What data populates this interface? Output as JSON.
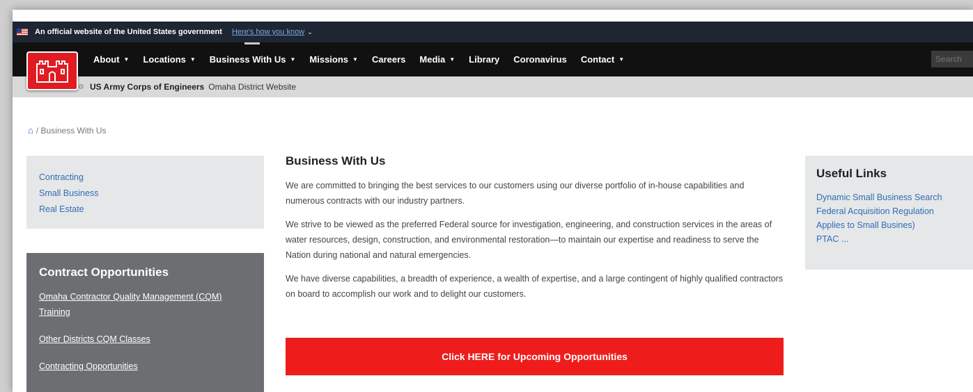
{
  "gov_banner": {
    "text": "An official website of the United States government",
    "link": "Here's how you know"
  },
  "nav": {
    "items": [
      {
        "label": "About",
        "dropdown": true
      },
      {
        "label": "Locations",
        "dropdown": true
      },
      {
        "label": "Business With Us",
        "dropdown": true
      },
      {
        "label": "Missions",
        "dropdown": true
      },
      {
        "label": "Careers",
        "dropdown": false
      },
      {
        "label": "Media",
        "dropdown": true
      },
      {
        "label": "Library",
        "dropdown": false
      },
      {
        "label": "Coronavirus",
        "dropdown": false
      },
      {
        "label": "Contact",
        "dropdown": true
      }
    ],
    "search_placeholder": "Search"
  },
  "site_bar": {
    "org": "US Army Corps of Engineers",
    "district": "Omaha District Website"
  },
  "breadcrumb": {
    "current": "Business With Us"
  },
  "sidebar": {
    "links": [
      "Contracting",
      "Small Business",
      "Real Estate"
    ]
  },
  "contract_box": {
    "title": "Contract Opportunities",
    "links": [
      "Omaha Contractor Quality Management (CQM) Training",
      "Other Districts CQM Classes",
      "Contracting Opportunities"
    ]
  },
  "main": {
    "title": "Business With Us",
    "paragraphs": [
      "We are committed to bringing the best services to our customers using our diverse portfolio of in-house capabilities and numerous contracts with our industry partners.",
      "We strive to be viewed as the preferred Federal source for investigation, engineering, and construction services in the areas of water resources, design, construction, and environmental restoration—to maintain our expertise and readiness to serve the Nation during national and natural emergencies.",
      "We have diverse capabilities, a breadth of experience, a wealth of expertise, and a large contingent of highly qualified contractors on board to accomplish our work and to delight our customers."
    ],
    "cta": "Click HERE for Upcoming Opportunities"
  },
  "useful_links": {
    "title": "Useful Links",
    "links": [
      "Dynamic Small Business Search",
      "Federal Acquisition Regulation",
      "Applies to Small Busines)",
      "PTAC ..."
    ]
  },
  "colors": {
    "nav_bg": "#111111",
    "gov_banner_bg": "#1d2632",
    "brand_red": "#e01b22",
    "cta_red": "#ef1c1c",
    "link_blue": "#2f6db5",
    "panel_gray": "#e6e7e8",
    "contract_gray": "#6d6e71"
  }
}
